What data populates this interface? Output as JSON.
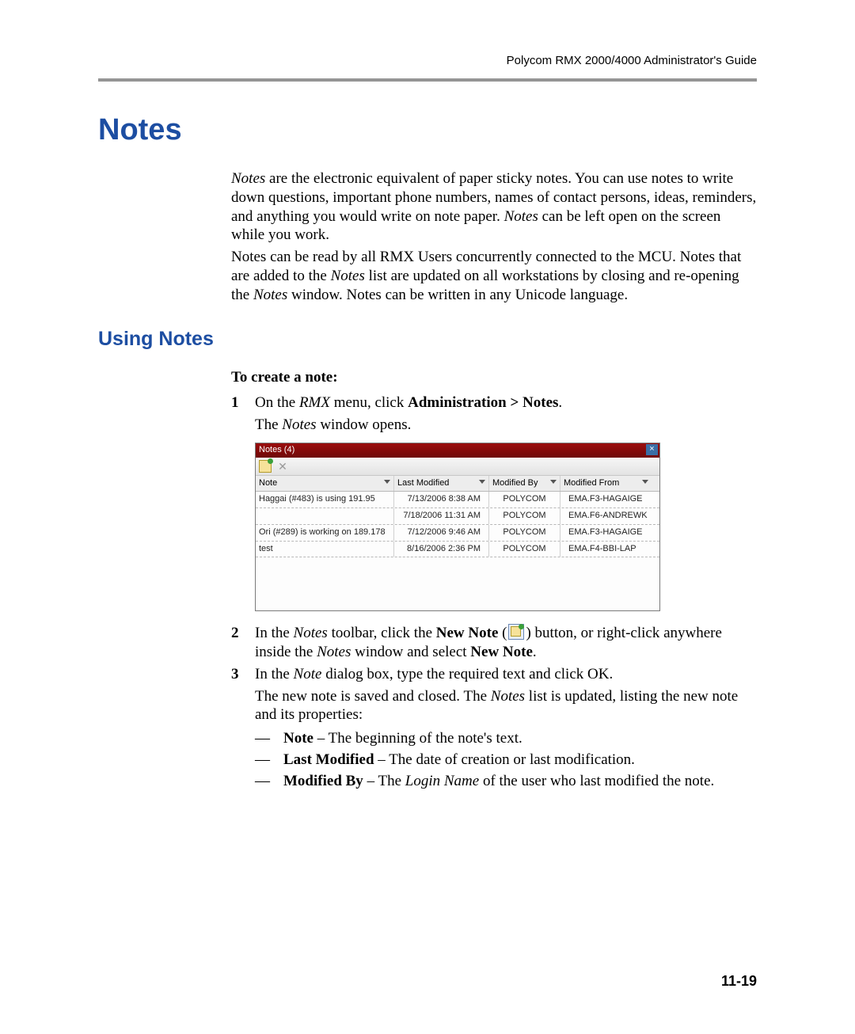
{
  "header": {
    "guide_title": "Polycom RMX 2000/4000 Administrator's Guide"
  },
  "h1": "Notes",
  "para1": {
    "a": "Notes",
    "b": " are the electronic equivalent of paper sticky notes. You can use notes to write down questions, important phone numbers, names of contact persons, ideas, reminders, and anything you would write on note paper. ",
    "c": "Notes",
    "d": " can be left open on the screen while you work."
  },
  "para2": {
    "a": "Notes can be read by all RMX Users concurrently connected to the MCU. Notes that are added to the ",
    "b": "Notes",
    "c": " list are updated on all workstations by closing and re-opening the ",
    "d": "Notes",
    "e": " window. Notes can be written in any Unicode language."
  },
  "h2": "Using Notes",
  "subhead": "To create a note:",
  "step1": {
    "num": "1",
    "a": "On the ",
    "b": "RMX",
    "c": " menu, click ",
    "d": "Administration > Notes",
    "e": ".",
    "f": "The ",
    "g": "Notes",
    "h": " window opens."
  },
  "notes_window": {
    "title": "Notes (4)",
    "close": "×",
    "columns": {
      "note": "Note",
      "last_modified": "Last Modified",
      "modified_by": "Modified By",
      "modified_from": "Modified From"
    },
    "rows": [
      {
        "note": "Haggai (#483) is using 191.95",
        "lm": "7/13/2006 8:38 AM",
        "mb": "POLYCOM",
        "mf": "EMA.F3-HAGAIGE"
      },
      {
        "note": "",
        "lm": "7/18/2006 11:31 AM",
        "mb": "POLYCOM",
        "mf": "EMA.F6-ANDREWK"
      },
      {
        "note": "Ori (#289) is working on 189.178",
        "lm": "7/12/2006 9:46 AM",
        "mb": "POLYCOM",
        "mf": "EMA.F3-HAGAIGE"
      },
      {
        "note": "test",
        "lm": "8/16/2006 2:36 PM",
        "mb": "POLYCOM",
        "mf": "EMA.F4-BBI-LAP"
      }
    ]
  },
  "step2": {
    "num": "2",
    "a": "In the ",
    "b": "Notes",
    "c": " toolbar, click the ",
    "d": "New Note",
    "e": " (",
    "f": ") button, or right-click anywhere inside the ",
    "g": "Notes",
    "h": " window and select ",
    "i": "New Note",
    "j": "."
  },
  "step3": {
    "num": "3",
    "a": "In the ",
    "b": "Note",
    "c": " dialog box, type the required text and click OK."
  },
  "after3": {
    "a": "The new note is saved and closed. The ",
    "b": "Notes",
    "c": " list is updated, listing the new note and its properties:"
  },
  "dashes": [
    {
      "l": "Note",
      "t": " – The beginning of the note's text."
    },
    {
      "l": "Last Modified",
      "t": " – The date of creation or last modification."
    },
    {
      "l": "Modified By",
      "t_a": " – The ",
      "t_b": "Login Name",
      "t_c": " of the user who last modified the note."
    }
  ],
  "page_number": "11-19"
}
